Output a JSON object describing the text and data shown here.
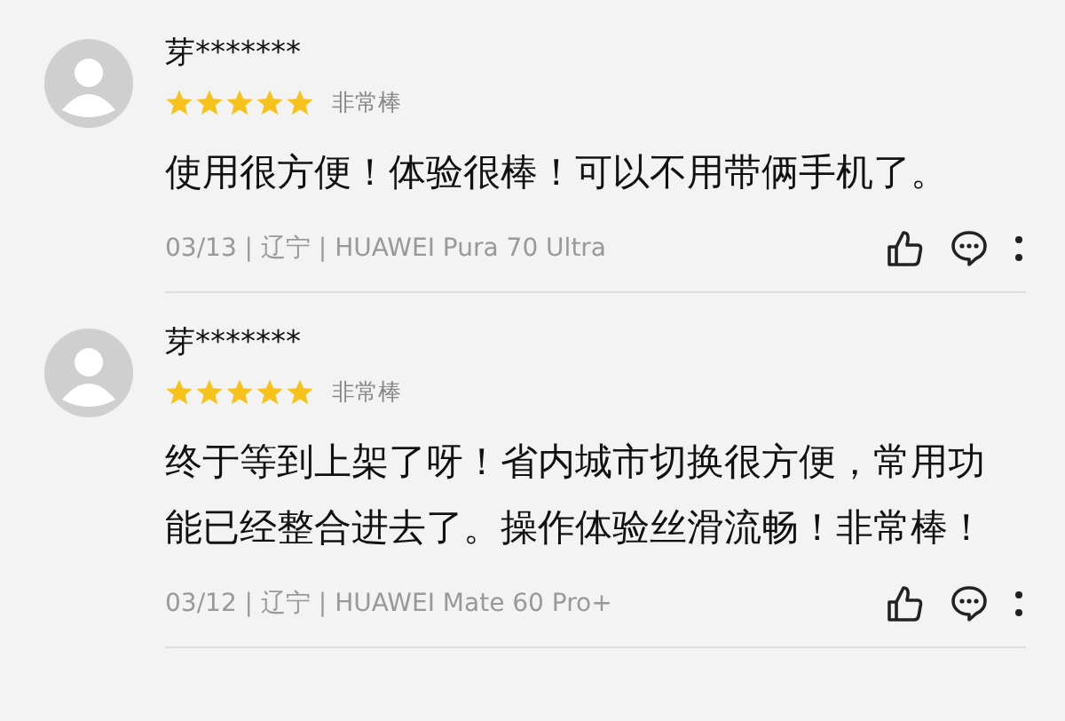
{
  "reviews": [
    {
      "user": "芽*******",
      "stars": 5,
      "rating_label": "非常棒",
      "text": "使用很方便！体验很棒！可以不用带俩手机了。",
      "meta": "03/13 | 辽宁 | HUAWEI Pura 70 Ultra"
    },
    {
      "user": "芽*******",
      "stars": 5,
      "rating_label": "非常棒",
      "text": "终于等到上架了呀！省内城市切换很方便，常用功能已经整合进去了。操作体验丝滑流畅！非常棒！",
      "meta": "03/12 | 辽宁 | HUAWEI Mate 60 Pro+"
    }
  ]
}
